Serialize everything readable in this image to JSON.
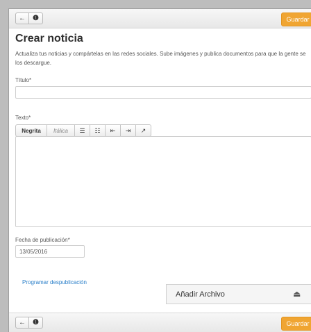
{
  "toolbar": {
    "back_icon": "←",
    "info_icon": "❶",
    "save_label": "Guardar"
  },
  "page": {
    "title": "Crear noticia",
    "description": "Actualiza tus noticias y compártelas en las redes sociales. Sube imágenes y publica documentos para que la gente se los descargue."
  },
  "form": {
    "title_label": "Título*",
    "title_value": "",
    "text_label": "Texto*",
    "text_value": "",
    "editor": {
      "bold_label": "Negrita",
      "italic_label": "Itálica",
      "icons": [
        "list-icon",
        "list-bullets-icon",
        "outdent-icon",
        "indent-icon",
        "share-icon"
      ]
    },
    "date_label": "Fecha de publicación*",
    "date_value": "13/05/2016",
    "schedule_link": "Programar despublicación",
    "attach_label": "Añadir Archivo"
  },
  "bottom_toolbar": {
    "back_icon": "←",
    "info_icon": "❶",
    "save_label": "Guardar"
  },
  "colors": {
    "accent": "#f0a532",
    "link": "#2a7fc9"
  }
}
